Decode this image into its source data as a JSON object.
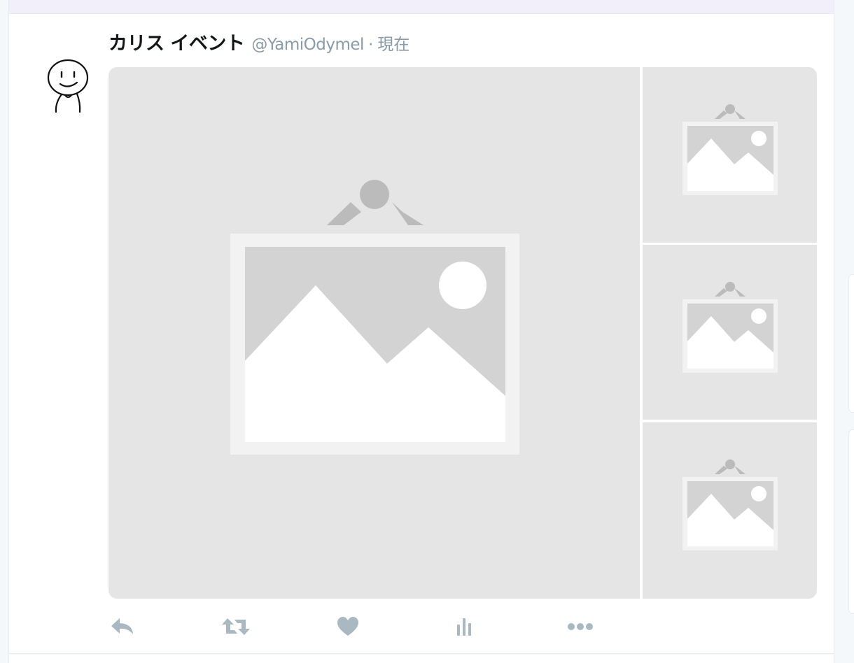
{
  "tweet": {
    "display_name": "カリス イベント",
    "handle": "@YamiOdymel",
    "separator": "·",
    "time": "現在"
  },
  "media": {
    "count": 4,
    "items": [
      {
        "kind": "image-placeholder"
      },
      {
        "kind": "image-placeholder"
      },
      {
        "kind": "image-placeholder"
      },
      {
        "kind": "image-placeholder"
      }
    ]
  },
  "actions": [
    {
      "name": "reply",
      "icon": "reply-icon"
    },
    {
      "name": "retweet",
      "icon": "retweet-icon"
    },
    {
      "name": "like",
      "icon": "heart-icon"
    },
    {
      "name": "analytics",
      "icon": "analytics-icon"
    },
    {
      "name": "more",
      "icon": "more-icon"
    }
  ],
  "colors": {
    "action_icon": "#aab8c2",
    "placeholder_bg": "#e5e5e5",
    "placeholder_frame": "#f2f2f2",
    "placeholder_sky": "#d3d3d3",
    "placeholder_hanger": "#bbbbbb",
    "handle_text": "#8a9ba8",
    "name_text": "#14171a"
  }
}
